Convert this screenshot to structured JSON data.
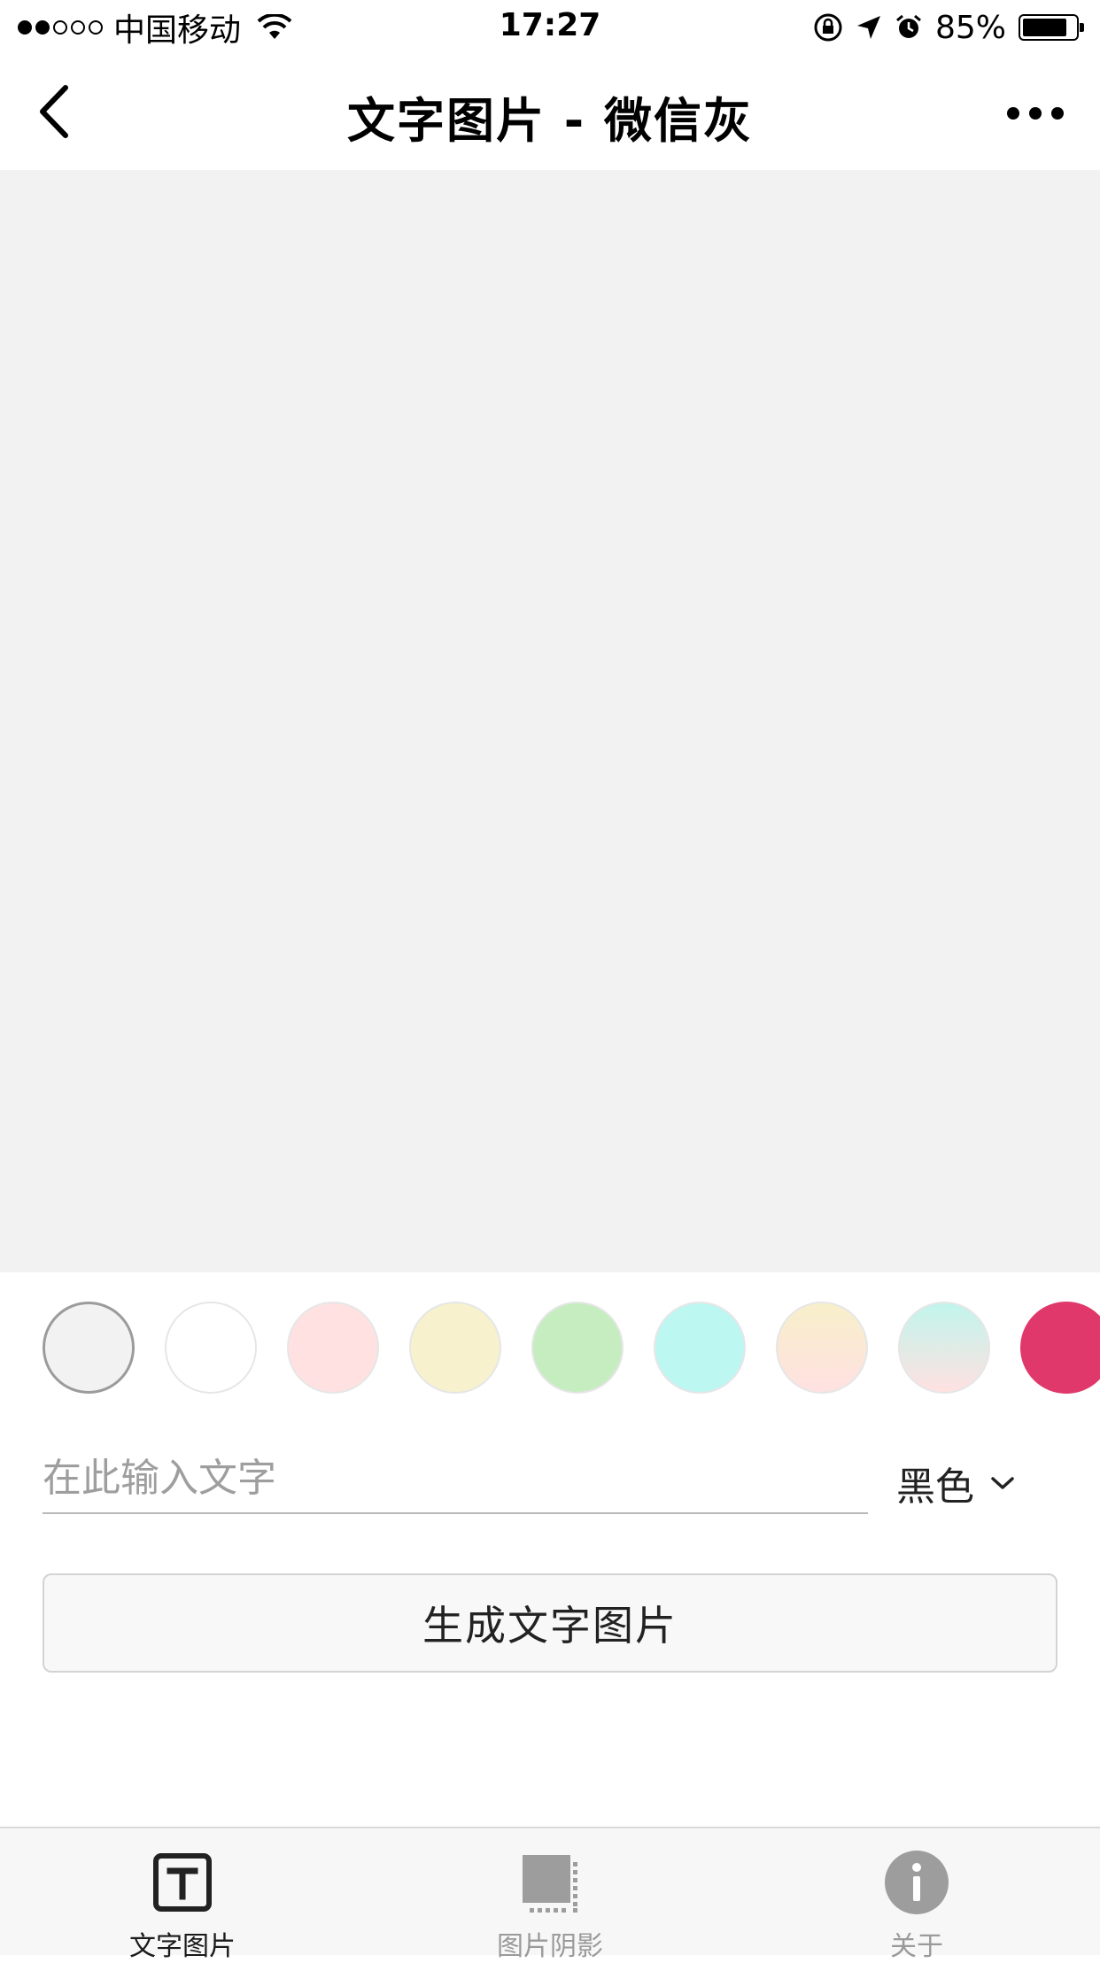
{
  "status_bar": {
    "carrier": "中国移动",
    "time": "17:27",
    "battery_text": "85%",
    "battery_level": 0.85,
    "signal_bars": [
      1,
      1,
      0,
      0,
      0
    ]
  },
  "nav": {
    "title": "文字图片 - 微信灰"
  },
  "preview": {
    "background_color": "#f2f2f2"
  },
  "swatches": [
    {
      "name": "wechat-gray",
      "color": "#f2f2f2",
      "selected": true
    },
    {
      "name": "white",
      "color": "#ffffff",
      "selected": false
    },
    {
      "name": "light-pink",
      "color": "#ffe1e1",
      "selected": false
    },
    {
      "name": "light-yellow",
      "color": "#f7f2cd",
      "selected": false
    },
    {
      "name": "light-green",
      "color": "#c5edc0",
      "selected": false
    },
    {
      "name": "light-cyan",
      "color": "#bdf7f1",
      "selected": false
    },
    {
      "name": "yellow-pink-gradient",
      "color": "linear-gradient(#f7efca,#ffe1e1)",
      "selected": false
    },
    {
      "name": "cyan-pink-gradient",
      "color": "linear-gradient(#c1f5ec,#ffe1e1)",
      "selected": false
    },
    {
      "name": "crimson",
      "color": "#e0386a",
      "selected": false
    }
  ],
  "input": {
    "placeholder": "在此输入文字",
    "value": ""
  },
  "text_color_select": {
    "selected": "黑色"
  },
  "generate_button": {
    "label": "生成文字图片"
  },
  "tabs": [
    {
      "label": "文字图片",
      "icon": "text-icon",
      "active": true
    },
    {
      "label": "图片阴影",
      "icon": "image-shadow-icon",
      "active": false
    },
    {
      "label": "关于",
      "icon": "info-icon",
      "active": false
    }
  ]
}
